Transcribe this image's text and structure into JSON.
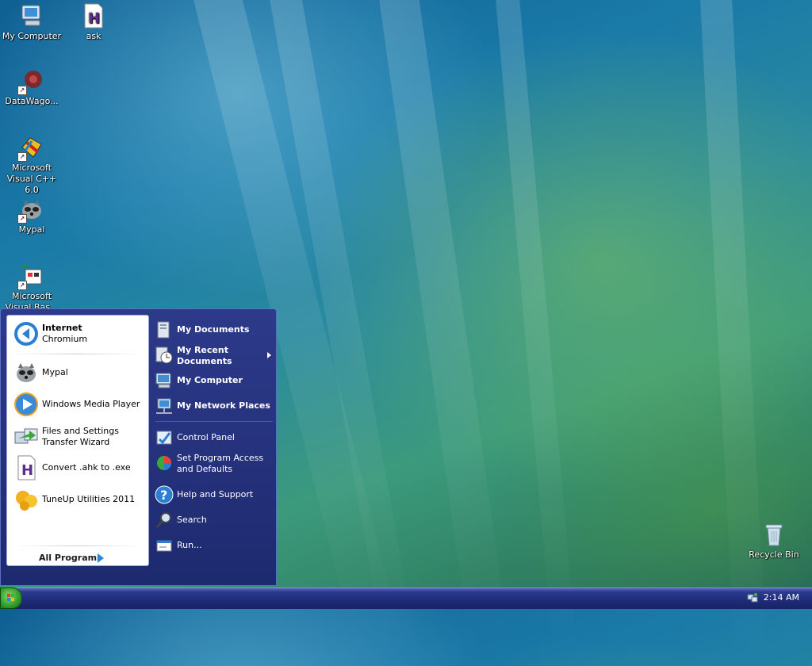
{
  "desktop": {
    "icons": [
      {
        "label": "My Computer",
        "icon": "my-computer-icon"
      },
      {
        "label": "ask",
        "icon": "ahk-script-icon"
      },
      {
        "label": "DataWago...",
        "icon": "datawagon-icon"
      },
      {
        "label": "Microsoft Visual C++ 6.0",
        "icon": "visual-cpp-icon"
      },
      {
        "label": "Mypal",
        "icon": "mypal-icon"
      },
      {
        "label": "Microsoft Visual Bas...",
        "icon": "visual-basic-icon"
      },
      {
        "label": "Recycle Bin",
        "icon": "recycle-bin-icon"
      }
    ]
  },
  "start_menu": {
    "pinned": [
      {
        "title": "Internet",
        "subtitle": "Chromium",
        "icon": "chromium-icon"
      }
    ],
    "recent": [
      {
        "label": "Mypal",
        "icon": "mypal-icon"
      },
      {
        "label": "Windows Media Player",
        "icon": "media-player-icon"
      },
      {
        "label_line1": "Files and Settings",
        "label_line2": "Transfer Wizard",
        "icon": "transfer-wizard-icon"
      },
      {
        "label": "Convert .ahk to .exe",
        "icon": "ahk-convert-icon"
      },
      {
        "label": "TuneUp Utilities 2011",
        "icon": "tuneup-icon"
      }
    ],
    "all_programs": "All Programs",
    "right": {
      "my_documents": "My Documents",
      "my_recent_line1": "My Recent",
      "my_recent_line2": "Documents",
      "my_computer": "My Computer",
      "my_network_places": "My Network Places",
      "control_panel": "Control Panel",
      "set_program_line1": "Set Program Access",
      "set_program_line2": "and Defaults",
      "help_and_support": "Help and Support",
      "search": "Search",
      "run": "Run..."
    }
  },
  "taskbar": {
    "clock": "2:14 AM"
  },
  "colors": {
    "start_menu_bg": "#1e2a6f",
    "taskbar": "#1e2c76",
    "start_button": "#2e9a2a"
  }
}
